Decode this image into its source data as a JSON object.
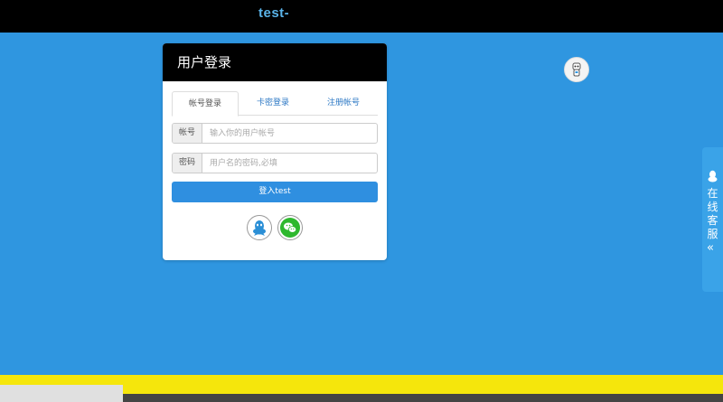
{
  "site": {
    "title": "test-"
  },
  "panel": {
    "title": "用户登录",
    "tabs": [
      "帐号登录",
      "卡密登录",
      "注册帐号"
    ],
    "active_tab": "帐号登录",
    "username": {
      "label": "帐号",
      "placeholder": "输入你的用户帐号",
      "value": ""
    },
    "password": {
      "label": "密码",
      "placeholder": "用户名的密码,必填",
      "value": ""
    },
    "login_button": "登入test",
    "social_logins": [
      "qq-icon",
      "wechat-icon"
    ]
  },
  "customer_service": {
    "label": "在线客服",
    "arrow": "«"
  },
  "colors": {
    "background": "#2f96e0",
    "topbar": "#000000",
    "title": "#5ab3e8",
    "button": "#2f8fe0",
    "bottom_bar": "#f5e60c"
  }
}
